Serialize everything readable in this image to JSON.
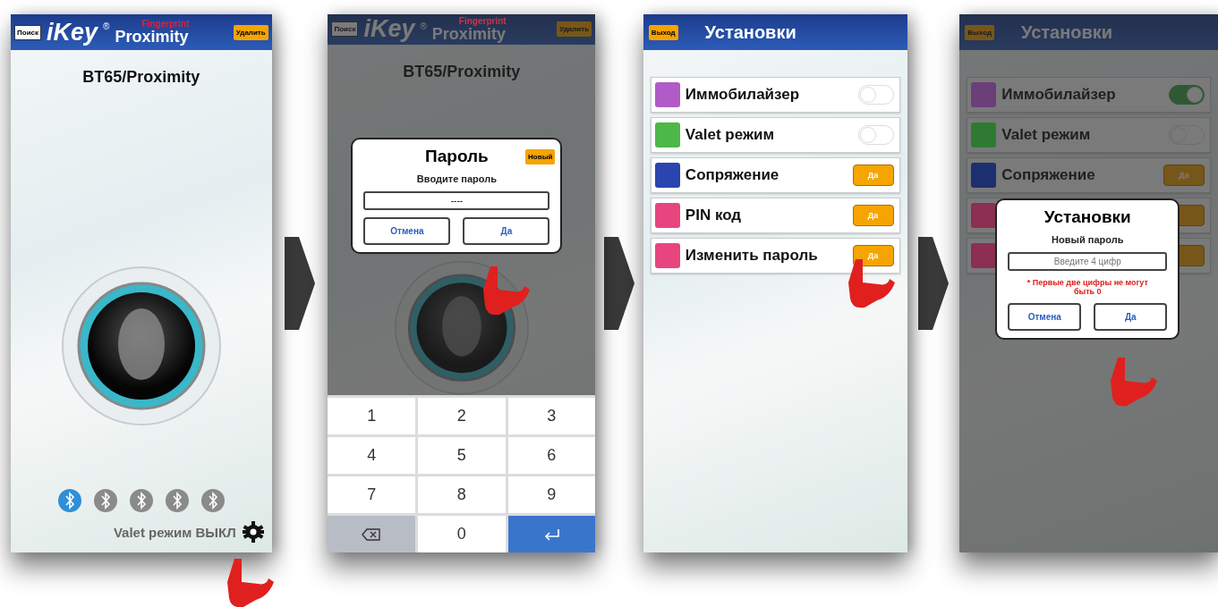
{
  "screens": [
    {
      "kind": "home",
      "dimmed": false,
      "header": {
        "search_button": "Поиск",
        "logo": "iKey",
        "registered": "®",
        "subtitle": "Fingerprint",
        "product": "Proximity",
        "delete_button": "Удалить"
      },
      "device": "BT65/Proximity",
      "bluetooth": [
        {
          "selected": true
        },
        {
          "selected": false
        },
        {
          "selected": false
        },
        {
          "selected": false
        },
        {
          "selected": false
        }
      ],
      "valet_status": "Valet режим ВЫКЛ"
    },
    {
      "kind": "password",
      "dimmed": true,
      "header": {
        "search_button": "Поиск",
        "logo": "iKey",
        "registered": "®",
        "subtitle": "Fingerprint",
        "product": "Proximity",
        "delete_button": "Удалить"
      },
      "device": "BT65/Proximity",
      "dialog": {
        "title": "Пароль",
        "new_button": "Новый",
        "prompt": "Вводите пароль",
        "value": "----",
        "buttons": [
          "Отмена",
          "Да"
        ]
      },
      "keypad": [
        {
          "kind": "digit",
          "label": "1"
        },
        {
          "kind": "digit",
          "label": "2"
        },
        {
          "kind": "digit",
          "label": "3"
        },
        {
          "kind": "digit",
          "label": "4"
        },
        {
          "kind": "digit",
          "label": "5"
        },
        {
          "kind": "digit",
          "label": "6"
        },
        {
          "kind": "digit",
          "label": "7"
        },
        {
          "kind": "digit",
          "label": "8"
        },
        {
          "kind": "digit",
          "label": "9"
        },
        {
          "kind": "backspace"
        },
        {
          "kind": "digit",
          "label": "0"
        },
        {
          "kind": "enter"
        }
      ]
    },
    {
      "kind": "settings",
      "dimmed": false,
      "header": {
        "exit_button": "Выход",
        "title": "Установки"
      },
      "rows": [
        {
          "kind": "switch",
          "label": "Иммобилайзер",
          "color": "#b05cc8",
          "on": false
        },
        {
          "kind": "switch",
          "label": "Valet режим",
          "color": "#4cb848",
          "on": false
        },
        {
          "kind": "button",
          "label": "Сопряжение",
          "color": "#2a45b0",
          "button": "Да"
        },
        {
          "kind": "button",
          "label": "PIN код",
          "color": "#e8457f",
          "button": "Да"
        },
        {
          "kind": "button",
          "label": "Изменить пароль",
          "color": "#e8457f",
          "button": "Да"
        }
      ]
    },
    {
      "kind": "settings",
      "dimmed": true,
      "header": {
        "exit_button": "Выход",
        "title": "Установки"
      },
      "rows": [
        {
          "kind": "switch",
          "label": "Иммобилайзер",
          "color": "#6a3f78",
          "on": true
        },
        {
          "kind": "switch",
          "label": "Valet режим",
          "color": "#2f7a33",
          "on": false
        },
        {
          "kind": "button",
          "label": "Сопряжение",
          "color": "#1c2f6e",
          "button": "Да"
        },
        {
          "kind": "button",
          "color": "#8c2f52"
        },
        {
          "kind": "button",
          "color": "#8c2f52"
        }
      ],
      "dialog": {
        "title": "Установки",
        "prompt": "Новый пароль",
        "placeholder": "Введите 4 цифр",
        "warning": "* Первые две цифры не могут быть 0",
        "buttons": [
          "Отмена",
          "Да"
        ]
      }
    }
  ]
}
